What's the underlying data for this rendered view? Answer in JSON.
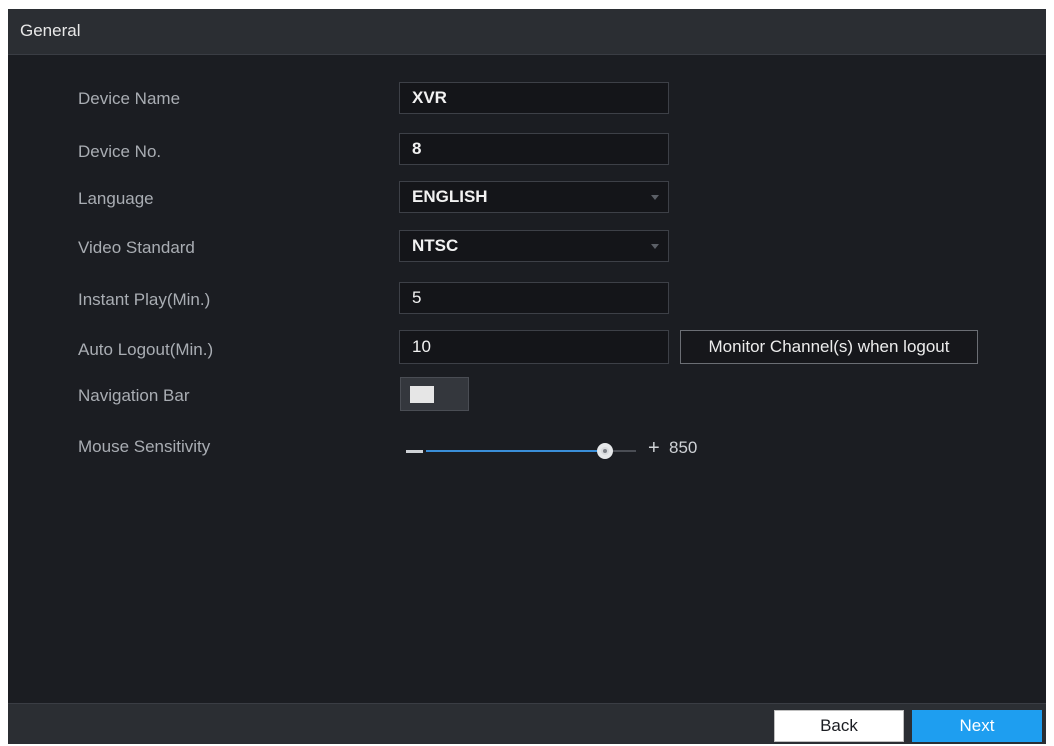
{
  "window": {
    "title": "General"
  },
  "form": {
    "device_name": {
      "label": "Device Name",
      "value": "XVR"
    },
    "device_no": {
      "label": "Device No.",
      "value": "8"
    },
    "language": {
      "label": "Language",
      "value": "ENGLISH"
    },
    "video_standard": {
      "label": "Video Standard",
      "value": "NTSC"
    },
    "instant_play": {
      "label": "Instant Play(Min.)",
      "value": "5"
    },
    "auto_logout": {
      "label": "Auto Logout(Min.)",
      "value": "10",
      "monitor_button": "Monitor Channel(s) when logout"
    },
    "navigation_bar": {
      "label": "Navigation Bar",
      "enabled": false
    },
    "mouse_sensitivity": {
      "label": "Mouse Sensitivity",
      "plus": "+",
      "value": "850",
      "level_fraction": 0.85
    }
  },
  "footer": {
    "back_label": "Back",
    "next_label": "Next"
  },
  "colors": {
    "accent": "#1e9ef0",
    "background": "#1b1d22",
    "panel": "#2b2e33"
  }
}
